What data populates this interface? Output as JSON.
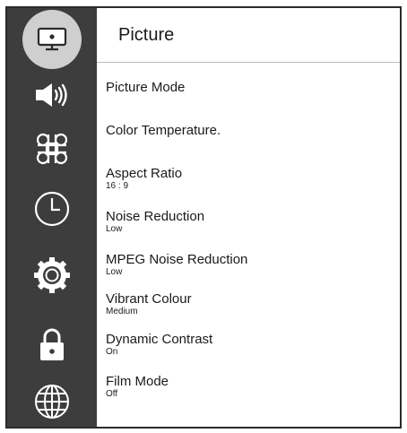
{
  "sidebar": {
    "items": [
      {
        "icon": "picture-monitor-icon",
        "active": true
      },
      {
        "icon": "speaker-sound-icon",
        "active": false
      },
      {
        "icon": "command-key-icon",
        "active": false
      },
      {
        "icon": "clock-icon",
        "active": false
      },
      {
        "icon": "gear-icon",
        "active": false
      },
      {
        "icon": "lock-icon",
        "active": false
      },
      {
        "icon": "globe-icon",
        "active": false
      }
    ],
    "colors": {
      "background": "#3d3d3d",
      "active_disc": "#cfcfcf",
      "icon": "#ffffff"
    }
  },
  "header": {
    "title": "Picture"
  },
  "menu": [
    {
      "label": "Picture Mode",
      "value": ""
    },
    {
      "label": "Color Temperature.",
      "value": ""
    },
    {
      "label": "Aspect Ratio",
      "value": "16 : 9"
    },
    {
      "label": "Noise Reduction",
      "value": "Low"
    },
    {
      "label": "MPEG Noise Reduction",
      "value": "Low"
    },
    {
      "label": "Vibrant Colour",
      "value": "Medium"
    },
    {
      "label": "Dynamic Contrast",
      "value": "On"
    },
    {
      "label": "Film Mode",
      "value": "Off"
    }
  ]
}
